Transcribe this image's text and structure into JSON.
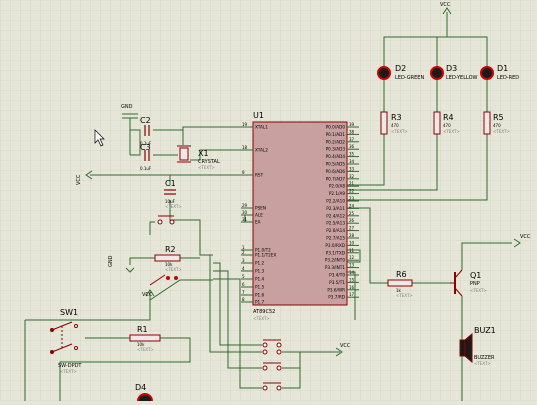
{
  "colors": {
    "background": "#e6e6d8",
    "grid": "#c9c9b8",
    "wire": "#2d6a2d",
    "component": "#8b0000",
    "chip_fill": "#c8a0a0",
    "label": "#000000",
    "placeholder_text": "#808080",
    "led_body": "#1a1a1a",
    "led_glow": "#cc0000"
  },
  "mcu": {
    "ref": "U1",
    "part": "AT89C52",
    "placeholder": "<TEXT>",
    "left_pins": [
      {
        "num": "19",
        "name": "XTAL1"
      },
      {
        "num": "18",
        "name": "XTAL2"
      },
      {
        "num": "9",
        "name": "RST"
      },
      {
        "num": "29",
        "name": "PSEN"
      },
      {
        "num": "30",
        "name": "ALE"
      },
      {
        "num": "31",
        "name": "EA"
      },
      {
        "num": "1",
        "name": "P1.0/T2"
      },
      {
        "num": "2",
        "name": "P1.1/T2EX"
      },
      {
        "num": "3",
        "name": "P1.2"
      },
      {
        "num": "4",
        "name": "P1.3"
      },
      {
        "num": "5",
        "name": "P1.4"
      },
      {
        "num": "6",
        "name": "P1.5"
      },
      {
        "num": "7",
        "name": "P1.6"
      },
      {
        "num": "8",
        "name": "P1.7"
      }
    ],
    "right_pins": [
      {
        "num": "39",
        "name": "P0.0/AD0"
      },
      {
        "num": "38",
        "name": "P0.1/AD1"
      },
      {
        "num": "37",
        "name": "P0.2/AD2"
      },
      {
        "num": "36",
        "name": "P0.3/AD3"
      },
      {
        "num": "35",
        "name": "P0.4/AD4"
      },
      {
        "num": "34",
        "name": "P0.5/AD5"
      },
      {
        "num": "33",
        "name": "P0.6/AD6"
      },
      {
        "num": "32",
        "name": "P0.7/AD7"
      },
      {
        "num": "21",
        "name": "P2.0/A8"
      },
      {
        "num": "22",
        "name": "P2.1/A9"
      },
      {
        "num": "23",
        "name": "P2.2/A10"
      },
      {
        "num": "24",
        "name": "P2.3/A11"
      },
      {
        "num": "25",
        "name": "P2.4/A12"
      },
      {
        "num": "26",
        "name": "P2.5/A13"
      },
      {
        "num": "27",
        "name": "P2.6/A14"
      },
      {
        "num": "28",
        "name": "P2.7/A15"
      },
      {
        "num": "10",
        "name": "P3.0/RXD"
      },
      {
        "num": "11",
        "name": "P3.1/TXD"
      },
      {
        "num": "12",
        "name": "P3.2/INT0"
      },
      {
        "num": "13",
        "name": "P3.3/INT1"
      },
      {
        "num": "14",
        "name": "P3.4/T0"
      },
      {
        "num": "15",
        "name": "P3.5/T1"
      },
      {
        "num": "16",
        "name": "P3.6/WR"
      },
      {
        "num": "17",
        "name": "P3.7/RD"
      }
    ]
  },
  "leds": [
    {
      "ref": "D2",
      "label": "LED-GREEN"
    },
    {
      "ref": "D3",
      "label": "LED-YELLOW"
    },
    {
      "ref": "D1",
      "label": "LED-RED"
    }
  ],
  "resistors": {
    "r3": {
      "ref": "R3",
      "value": "470"
    },
    "r4": {
      "ref": "R4",
      "value": "470"
    },
    "r5": {
      "ref": "R5",
      "value": "470"
    },
    "r2": {
      "ref": "R2",
      "value": "10k"
    },
    "r6": {
      "ref": "R6",
      "value": "1k"
    },
    "r1": {
      "ref": "R1",
      "value": "10k"
    }
  },
  "capacitors": {
    "c2": {
      "ref": "C2",
      "value": "0.1uF"
    },
    "c3": {
      "ref": "C3",
      "value": "0.1uF"
    },
    "c1": {
      "ref": "C1",
      "value": "10uF"
    }
  },
  "crystal": {
    "ref": "X1",
    "label": "CRYSTAL"
  },
  "transistor": {
    "ref": "Q1",
    "type": "PNP"
  },
  "buzzer": {
    "ref": "BUZ1",
    "label": "BUZZER"
  },
  "switch": {
    "ref": "SW1",
    "label": "SW-DPDT"
  },
  "diode_bottom": {
    "ref": "D4"
  },
  "power": {
    "vcc": "VCC",
    "gnd": "GND"
  },
  "placeholder": "<TEXT>"
}
